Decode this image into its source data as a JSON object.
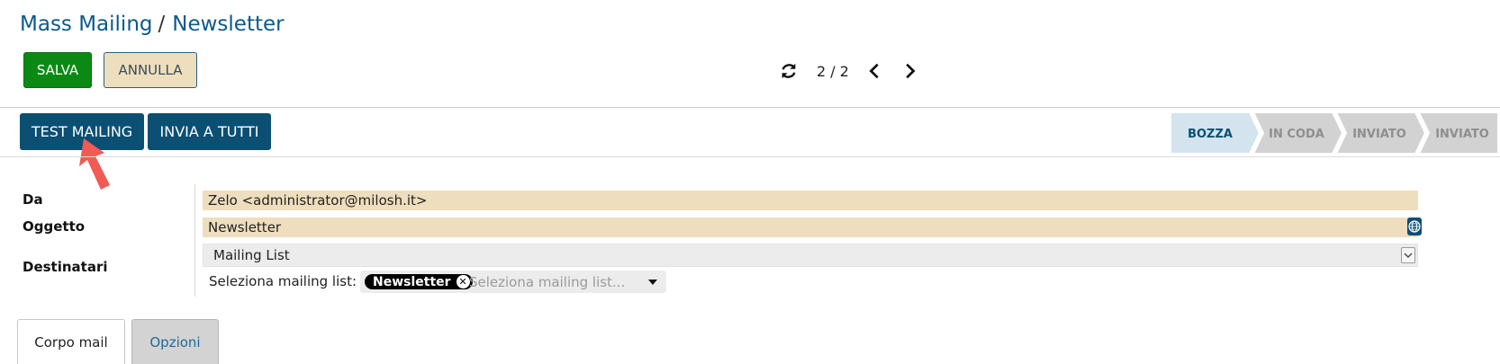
{
  "breadcrumb": {
    "parent": "Mass Mailing",
    "separator": "/",
    "current": "Newsletter"
  },
  "actions": {
    "save_label": "SALVA",
    "cancel_label": "ANNULLA"
  },
  "pager": {
    "count": "2 / 2"
  },
  "toolbar": {
    "test_label": "TEST MAILING",
    "send_all_label": "INVIA A TUTTI"
  },
  "status_bar": {
    "stages": [
      {
        "label": "BOZZA",
        "active": true
      },
      {
        "label": "IN CODA",
        "active": false
      },
      {
        "label": "INVIATO",
        "active": false
      },
      {
        "label": "INVIATO",
        "active": false
      }
    ],
    "colors": {
      "active_bg": "#d3e4ee",
      "active_text": "#0b4f73",
      "inactive_bg": "#d2d2d2",
      "inactive_text": "#8e8e8e"
    }
  },
  "form": {
    "from_label": "Da",
    "from_value": "Zelo <administrator@milosh.it>",
    "subject_label": "Oggetto",
    "subject_value": "Newsletter",
    "recipients_label": "Destinatari",
    "recipients_model": "Mailing List",
    "mailing_list_label": "Seleziona mailing list:",
    "mailing_list_tag": "Newsletter",
    "mailing_list_placeholder": "Seleziona mailing list..."
  },
  "tabs": [
    {
      "label": "Corpo mail",
      "active": true
    },
    {
      "label": "Opzioni",
      "active": false
    }
  ],
  "icons": {
    "refresh": "refresh-icon",
    "prev": "chevron-left-icon",
    "next": "chevron-right-icon",
    "translate": "globe-icon",
    "pointer": "red-arrow-annotation"
  },
  "colors": {
    "brand": "#0b4f73",
    "link": "#0b5a8a",
    "save": "#0a8a15",
    "readonly_field": "#efdebd"
  }
}
